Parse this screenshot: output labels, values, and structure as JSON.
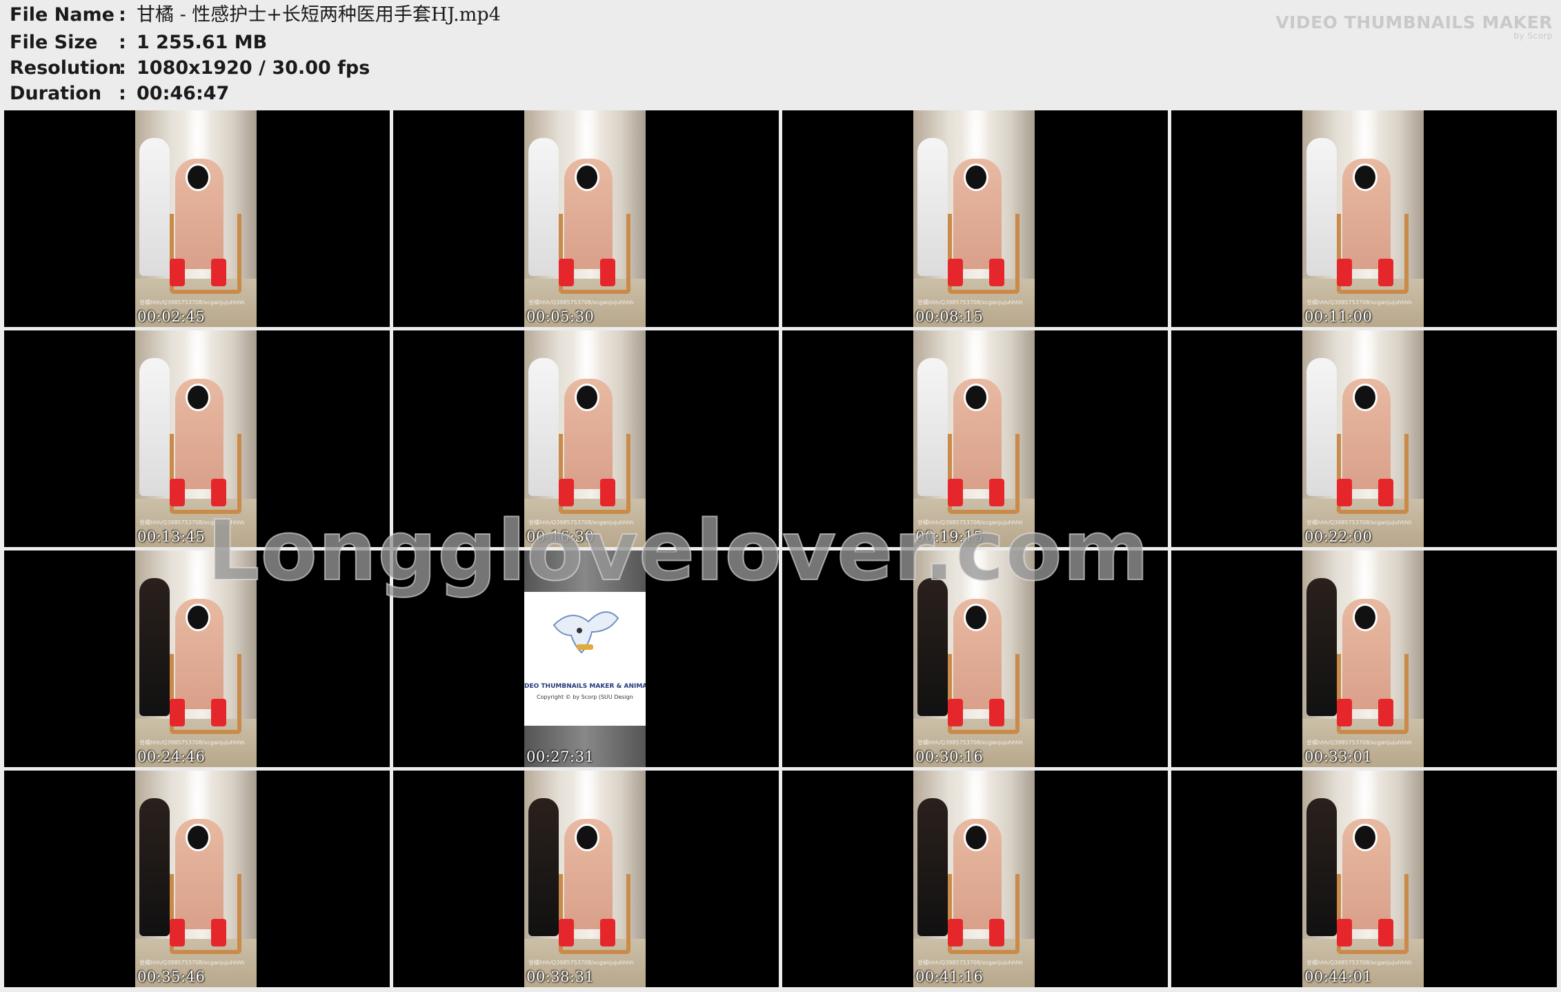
{
  "info": {
    "rows": [
      {
        "label": "File Name",
        "value": "甘橘 - 性感护士+长短两种医用手套HJ.mp4"
      },
      {
        "label": "File Size",
        "value": "1 255.61 MB"
      },
      {
        "label": "Resolution",
        "value": "1080x1920 / 30.00 fps"
      },
      {
        "label": "Duration",
        "value": "00:46:47"
      }
    ],
    "colon": ":"
  },
  "brand": {
    "title": "VIDEO THUMBNAILS MAKER",
    "by": "by Scorp"
  },
  "watermark": "Longglovelover.com",
  "thumb_watermark": "甘橘hhh/Q3985753708/xcganjujuhhhh",
  "logo_frame": {
    "title": "DEO THUMBNAILS MAKER & ANIMA",
    "copyright": "Copyright © by Scorp (SUU Design"
  },
  "thumbnails": [
    {
      "time": "00:02:45",
      "scene": "nurse"
    },
    {
      "time": "00:05:30",
      "scene": "nurse"
    },
    {
      "time": "00:08:15",
      "scene": "nurse"
    },
    {
      "time": "00:11:00",
      "scene": "nurse"
    },
    {
      "time": "00:13:45",
      "scene": "nurse"
    },
    {
      "time": "00:16:30",
      "scene": "nurse"
    },
    {
      "time": "00:19:15",
      "scene": "nurse"
    },
    {
      "time": "00:22:00",
      "scene": "nurse"
    },
    {
      "time": "00:24:46",
      "scene": "dark"
    },
    {
      "time": "00:27:31",
      "scene": "logo"
    },
    {
      "time": "00:30:16",
      "scene": "dark"
    },
    {
      "time": "00:33:01",
      "scene": "dark"
    },
    {
      "time": "00:35:46",
      "scene": "dark"
    },
    {
      "time": "00:38:31",
      "scene": "dark"
    },
    {
      "time": "00:41:16",
      "scene": "dark"
    },
    {
      "time": "00:44:01",
      "scene": "dark"
    }
  ]
}
